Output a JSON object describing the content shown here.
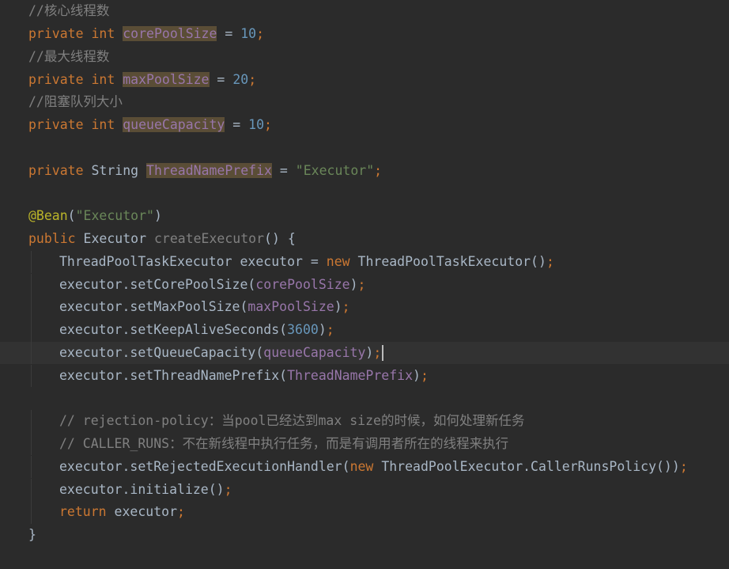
{
  "editor": {
    "colors": {
      "background": "#2b2b2b",
      "keyword": "#cc7832",
      "comment": "#808080",
      "field": "#9876aa",
      "field_highlight": "#5a4d36",
      "number": "#6897bb",
      "string": "#6a8759",
      "annotation": "#bbb529",
      "method_decl": "#ffc66d",
      "text": "#a9b7c6"
    },
    "lines": {
      "l1": {
        "comment": "//核心线程数"
      },
      "l2": {
        "kw": "private int ",
        "field": "corePoolSize",
        "op": " = ",
        "num": "10",
        "semi": ";"
      },
      "l3": {
        "comment": "//最大线程数"
      },
      "l4": {
        "kw": "private int ",
        "field": "maxPoolSize",
        "op": " = ",
        "num": "20",
        "semi": ";"
      },
      "l5": {
        "comment": "//阻塞队列大小"
      },
      "l6": {
        "kw": "private int ",
        "field": "queueCapacity",
        "op": " = ",
        "num": "10",
        "semi": ";"
      },
      "l8": {
        "kw": "private ",
        "type": "String ",
        "field": "ThreadNamePrefix",
        "op": " = ",
        "str": "\"Executor\"",
        "semi": ";"
      },
      "l10": {
        "ann": "@Bean",
        "p1": "(",
        "str": "\"Executor\"",
        "p2": ")"
      },
      "l11": {
        "kw": "public ",
        "type": "Executor ",
        "method": "createExecutor",
        "rest": "() {"
      },
      "l12": {
        "a": "ThreadPoolTaskExecutor executor = ",
        "kw": "new ",
        "b": "ThreadPoolTaskExecutor()",
        "semi": ";"
      },
      "l13": {
        "a": "executor.setCorePoolSize(",
        "field": "corePoolSize",
        "b": ")",
        "semi": ";"
      },
      "l14": {
        "a": "executor.setMaxPoolSize(",
        "field": "maxPoolSize",
        "b": ")",
        "semi": ";"
      },
      "l15": {
        "a": "executor.setKeepAliveSeconds(",
        "num": "3600",
        "b": ")",
        "semi": ";"
      },
      "l16": {
        "a": "executor.setQueueCapacity(",
        "field": "queueCapacity",
        "b": ")",
        "semi": ";"
      },
      "l17": {
        "a": "executor.setThreadNamePrefix(",
        "field": "ThreadNamePrefix",
        "b": ")",
        "semi": ";"
      },
      "l19": {
        "comment": "// rejection-policy：当pool已经达到max size的时候，如何处理新任务"
      },
      "l20": {
        "comment": "// CALLER_RUNS：不在新线程中执行任务，而是有调用者所在的线程来执行"
      },
      "l21": {
        "a": "executor.setRejectedExecutionHandler(",
        "kw": "new ",
        "b": "ThreadPoolExecutor.CallerRunsPolicy())",
        "semi": ";"
      },
      "l22": {
        "a": "executor.initialize()",
        "semi": ";"
      },
      "l23": {
        "kw": "return ",
        "a": "executor",
        "semi": ";"
      },
      "l24": {
        "brace": "}"
      }
    }
  }
}
